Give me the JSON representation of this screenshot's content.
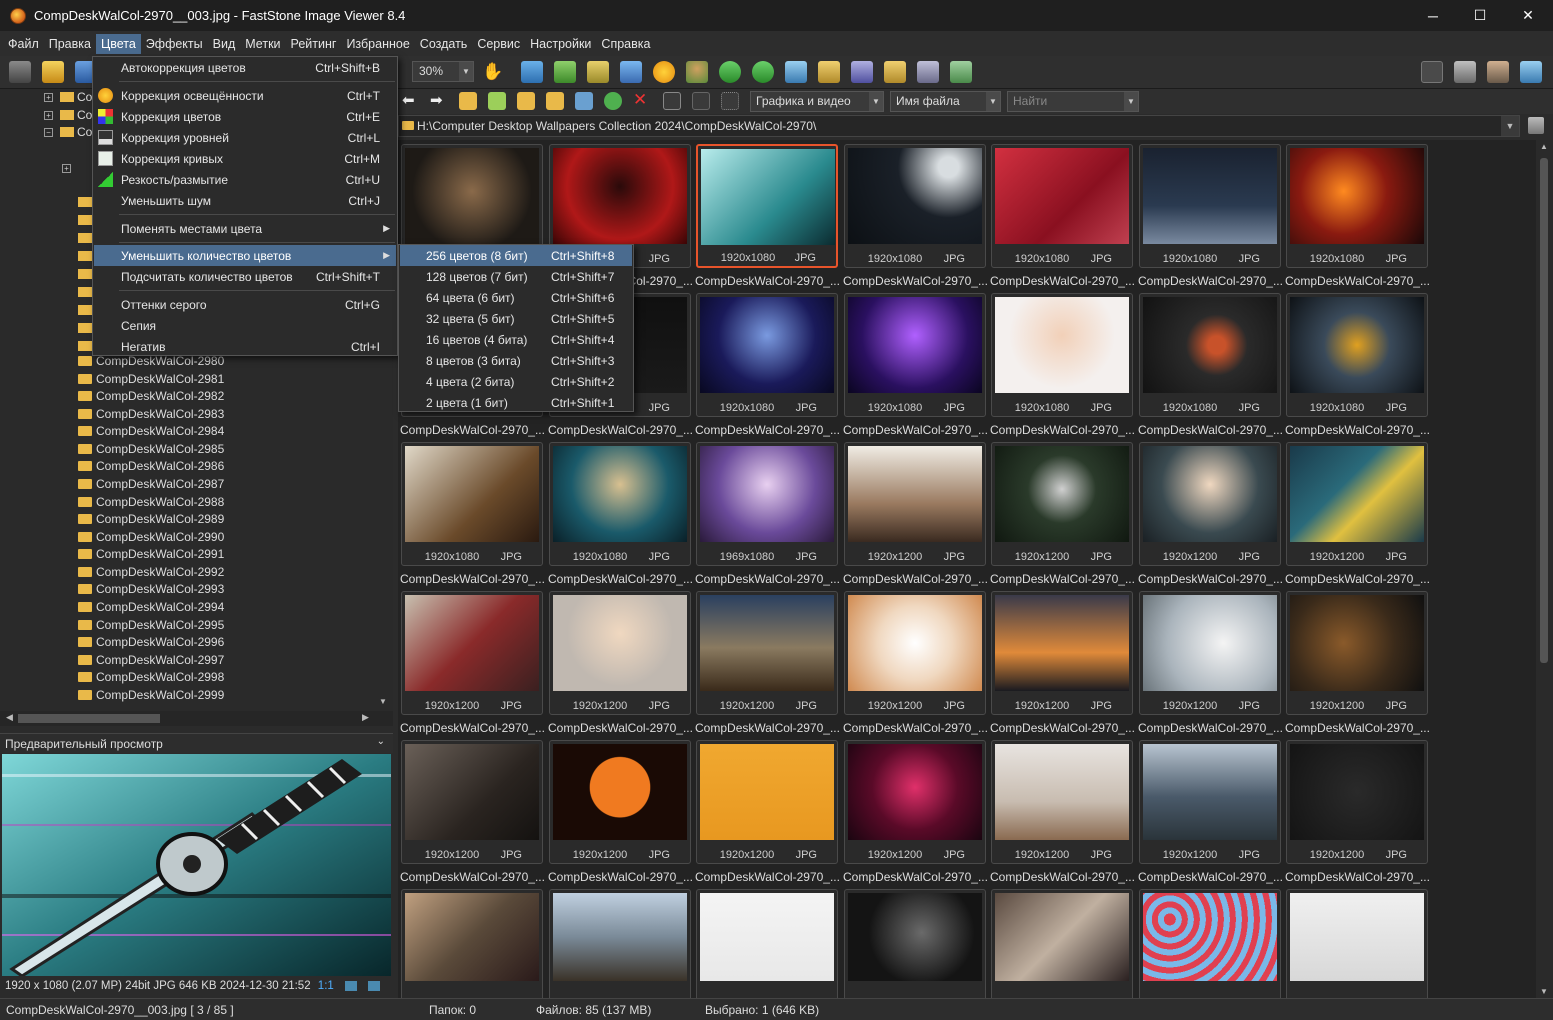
{
  "window": {
    "title": "CompDeskWalCol-2970__003.jpg - FastStone Image Viewer 8.4",
    "minimize": "─",
    "maximize": "☐",
    "close": "✕"
  },
  "menubar": [
    "Файл",
    "Правка",
    "Цвета",
    "Эффекты",
    "Вид",
    "Метки",
    "Рейтинг",
    "Избранное",
    "Создать",
    "Сервис",
    "Настройки",
    "Справка"
  ],
  "toolbar": {
    "zoom": "30%",
    "filter": "Графика и видео",
    "sort": "Имя файла",
    "search_placeholder": "Найти"
  },
  "path": "H:\\Computer Desktop Wallpapers Collection 2024\\CompDeskWalCol-2970\\",
  "colors_menu": {
    "items": [
      {
        "label": "Автокоррекция цветов",
        "shortcut": "Ctrl+Shift+B"
      },
      {
        "label": "Коррекция освещённости",
        "shortcut": "Ctrl+T"
      },
      {
        "label": "Коррекция цветов",
        "shortcut": "Ctrl+E"
      },
      {
        "label": "Коррекция уровней",
        "shortcut": "Ctrl+L"
      },
      {
        "label": "Коррекция кривых",
        "shortcut": "Ctrl+M"
      },
      {
        "label": "Резкость/размытие",
        "shortcut": "Ctrl+U"
      },
      {
        "label": "Уменьшить шум",
        "shortcut": "Ctrl+J"
      },
      {
        "label": "Поменять местами цвета",
        "shortcut": ""
      },
      {
        "label": "Уменьшить количество цветов",
        "shortcut": ""
      },
      {
        "label": "Подсчитать количество цветов",
        "shortcut": "Ctrl+Shift+T"
      },
      {
        "label": "Оттенки серого",
        "shortcut": "Ctrl+G"
      },
      {
        "label": "Сепия",
        "shortcut": ""
      },
      {
        "label": "Негатив",
        "shortcut": "Ctrl+I"
      }
    ]
  },
  "reduce_colors_submenu": [
    {
      "label": "256 цветов (8 бит)",
      "shortcut": "Ctrl+Shift+8"
    },
    {
      "label": "128 цветов (7 бит)",
      "shortcut": "Ctrl+Shift+7"
    },
    {
      "label": "64 цвета (6 бит)",
      "shortcut": "Ctrl+Shift+6"
    },
    {
      "label": "32 цвета (5 бит)",
      "shortcut": "Ctrl+Shift+5"
    },
    {
      "label": "16 цветов (4 бита)",
      "shortcut": "Ctrl+Shift+4"
    },
    {
      "label": "8 цветов (3 бита)",
      "shortcut": "Ctrl+Shift+3"
    },
    {
      "label": "4 цвета (2 бита)",
      "shortcut": "Ctrl+Shift+2"
    },
    {
      "label": "2 цвета (1 бит)",
      "shortcut": "Ctrl+Shift+1"
    }
  ],
  "tree": {
    "partial_labels": [
      "Co",
      "Co",
      "Co"
    ],
    "folders": [
      "CompDeskWalCol-2980",
      "CompDeskWalCol-2981",
      "CompDeskWalCol-2982",
      "CompDeskWalCol-2983",
      "CompDeskWalCol-2984",
      "CompDeskWalCol-2985",
      "CompDeskWalCol-2986",
      "CompDeskWalCol-2987",
      "CompDeskWalCol-2988",
      "CompDeskWalCol-2989",
      "CompDeskWalCol-2990",
      "CompDeskWalCol-2991",
      "CompDeskWalCol-2992",
      "CompDeskWalCol-2993",
      "CompDeskWalCol-2994",
      "CompDeskWalCol-2995",
      "CompDeskWalCol-2996",
      "CompDeskWalCol-2997",
      "CompDeskWalCol-2998",
      "CompDeskWalCol-2999"
    ]
  },
  "preview": {
    "header": "Предварительный просмотр",
    "info": "1920 x 1080 (2.07 MP)  24bit  JPG   646 KB   2024-12-30 21:52",
    "ratio": "1:1"
  },
  "thumbnails": {
    "caption": "CompDeskWalCol-2970_...",
    "format": "JPG",
    "dims": [
      "1920x1080",
      "1920x1080",
      "1920x1080",
      "1920x1080",
      "1920x1080",
      "1920x1080",
      "1920x1080",
      "1920x1080",
      "1920x1080",
      "1920x1080",
      "1920x1080",
      "1920x1080",
      "1920x1080",
      "1920x1080",
      "1920x1080",
      "1920x1080",
      "1969x1080",
      "1920x1200",
      "1920x1200",
      "1920x1200",
      "1920x1200",
      "1920x1200",
      "1920x1200",
      "1920x1200",
      "1920x1200",
      "1920x1200",
      "1920x1200",
      "1920x1200",
      "1920x1200",
      "1920x1200",
      "1920x1200",
      "1920x1200",
      "1920x1200",
      "1920x1200",
      "1920x1200"
    ],
    "selected_index": 2
  },
  "status": {
    "file": "CompDeskWalCol-2970__003.jpg [ 3 / 85 ]",
    "folders": "Папок: 0",
    "files": "Файлов: 85 (137 MB)",
    "selected": "Выбрано: 1 (646 KB)"
  }
}
